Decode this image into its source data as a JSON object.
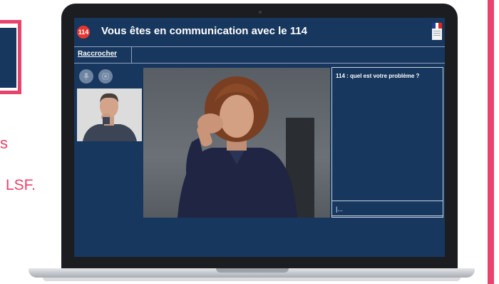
{
  "page": {
    "background_text": {
      "fragment": "s",
      "suffix": "LSF."
    }
  },
  "app": {
    "logo": "114",
    "title": "Vous êtes en communication avec le 114",
    "emblem": "republique-francaise-logo"
  },
  "toolbar": {
    "hangup_label": "Raccrocher"
  },
  "controls": {
    "mic_icon": "microphone-icon",
    "speaker_icon": "speaker-icon"
  },
  "video": {
    "self_view": "caller-self-view-video",
    "main_view": "sign-language-interpreter-video"
  },
  "chat": {
    "message": "114 : quel est votre problème ?",
    "input_value": "|..."
  },
  "colors": {
    "screen_bg": "#17375e",
    "accent_pink": "#e8436a",
    "logo_red": "#e8352f",
    "panel_border": "#c9d3df"
  }
}
